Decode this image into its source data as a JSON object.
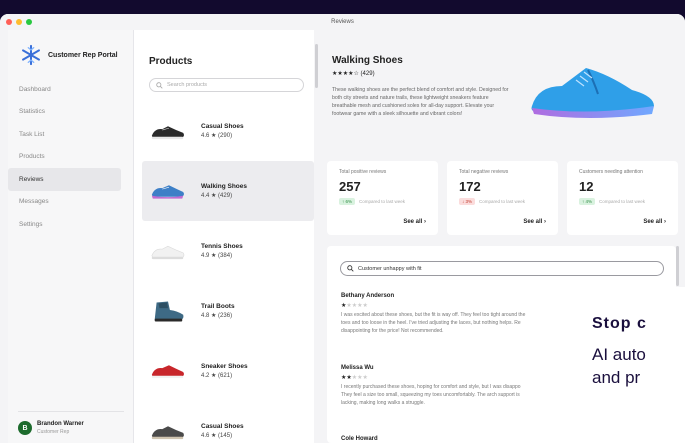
{
  "window": {
    "title": "Reviews"
  },
  "colors": {
    "close": "#ff5f57",
    "minimize": "#febc2e",
    "maximize": "#28c840",
    "accent": "#1a0f3d",
    "background": "#120a2e"
  },
  "sidebar": {
    "brand": "Customer Rep Portal",
    "items": [
      {
        "label": "Dashboard"
      },
      {
        "label": "Statistics"
      },
      {
        "label": "Task List"
      },
      {
        "label": "Products"
      },
      {
        "label": "Reviews"
      },
      {
        "label": "Messages"
      },
      {
        "label": "Settings"
      }
    ],
    "active": "Reviews",
    "user": {
      "initial": "B",
      "name": "Brandon Warner",
      "role": "Customer Rep"
    }
  },
  "products": {
    "title": "Products",
    "search_placeholder": "Search products",
    "items": [
      {
        "name": "Casual Shoes",
        "rating": "4.6 ★ (290)"
      },
      {
        "name": "Walking Shoes",
        "rating": "4.4 ★ (429)"
      },
      {
        "name": "Tennis Shoes",
        "rating": "4.9 ★ (384)"
      },
      {
        "name": "Trail Boots",
        "rating": "4.8 ★ (236)"
      },
      {
        "name": "Sneaker Shoes",
        "rating": "4.2 ★ (621)"
      },
      {
        "name": "Casual Shoes",
        "rating": "4.6 ★ (145)"
      }
    ]
  },
  "detail": {
    "name": "Walking Shoes",
    "rating": "★★★★☆ (429)",
    "description": "These walking shoes are the perfect blend of comfort and style. Designed for both city streets and nature trails, these lightweight sneakers feature breathable mesh and cushioned soles for all-day support. Elevate your footwear game with a sleek silhouette and vibrant colors!"
  },
  "stats": [
    {
      "label": "Total positive reviews",
      "value": "257",
      "delta": "↑ 6%",
      "direction": "up",
      "note": "Compared to last week",
      "link": "See all ›"
    },
    {
      "label": "Total negative reviews",
      "value": "172",
      "delta": "↓ 3%",
      "direction": "down",
      "note": "Compared to last week",
      "link": "See all ›"
    },
    {
      "label": "Customers needing attention",
      "value": "12",
      "delta": "↑ 4%",
      "direction": "up",
      "note": "Compared to last week",
      "link": "See all ›"
    }
  ],
  "reviews": {
    "search_value": "Customer unhappy with fit",
    "items": [
      {
        "name": "Bethany Anderson",
        "stars_on": "★",
        "stars_off": "★★★★",
        "line1": "I was excited about these shoes, but the fit is way off. They feel too tight around the",
        "line2": "toes and too loose in the heel. I've tried adjusting the laces, but nothing helps. Re",
        "line3": "disappointing for the price! Not recommended."
      },
      {
        "name": "Melissa Wu",
        "stars_on": "★★",
        "stars_off": "★★★",
        "line1": "I recently purchased these shoes, hoping for comfort and style, but I was disappo",
        "line2": "They feel a size too small, squeezing my toes uncomfortably. The arch support is",
        "line3": "lacking, making long walks a struggle."
      },
      {
        "name": "Cole Howard"
      }
    ]
  },
  "promo": {
    "title": "Stop c",
    "line1": "AI auto",
    "line2": "and pr"
  }
}
